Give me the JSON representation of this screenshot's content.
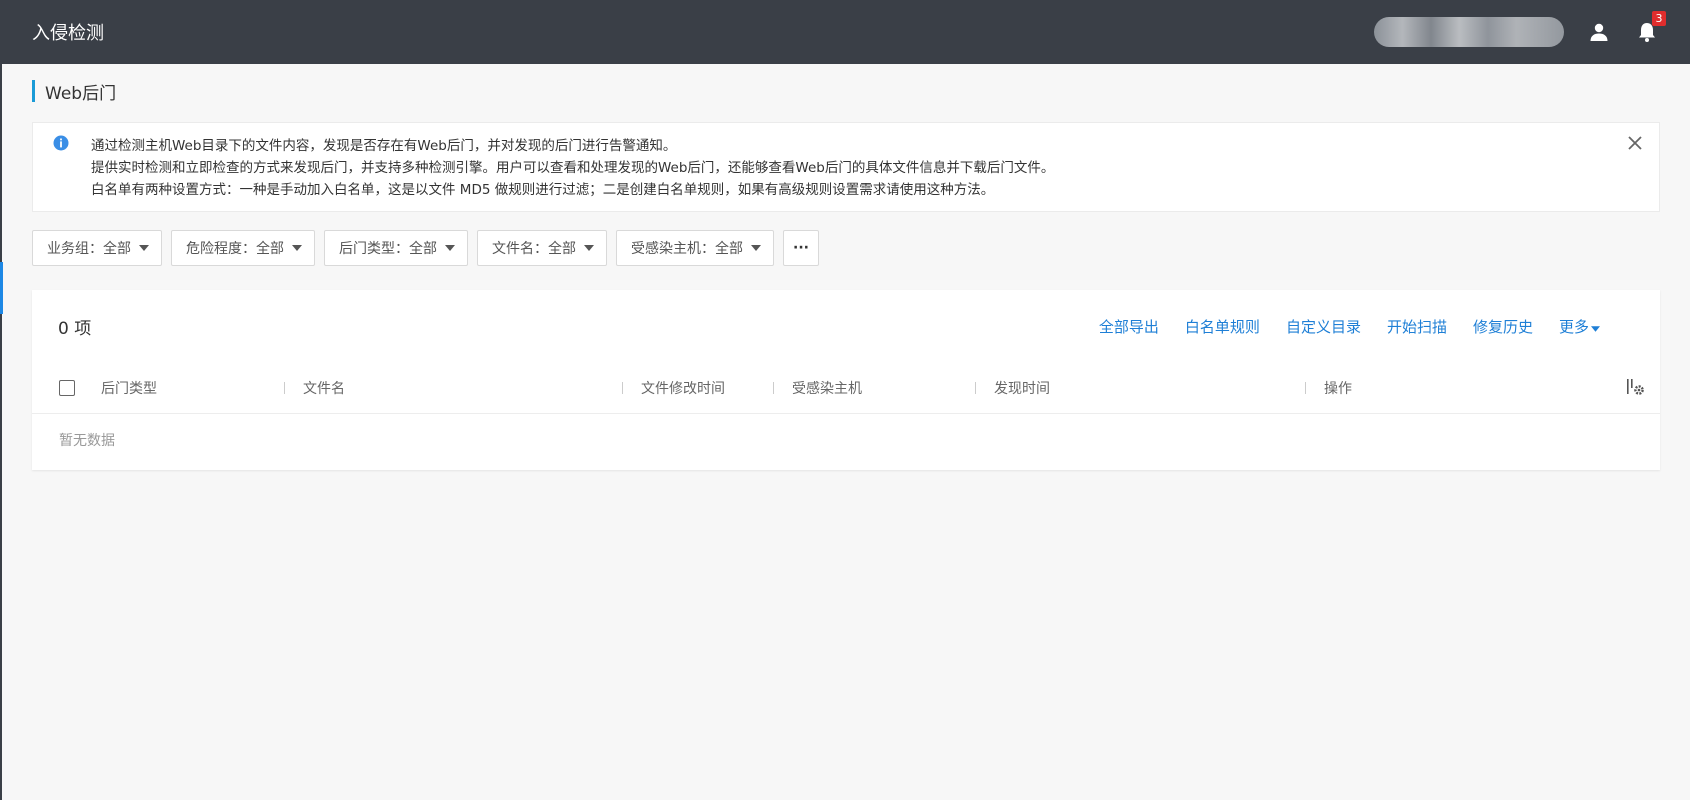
{
  "header": {
    "title": "入侵检测",
    "notification_count": "3"
  },
  "page": {
    "heading": "Web后门"
  },
  "info": {
    "lines": [
      "通过检测主机Web目录下的文件内容，发现是否存在有Web后门，并对发现的后门进行告警通知。",
      "提供实时检测和立即检查的方式来发现后门，并支持多种检测引擎。用户可以查看和处理发现的Web后门，还能够查看Web后门的具体文件信息并下载后门文件。",
      "白名单有两种设置方式：一种是手动加入白名单，这是以文件 MD5 做规则进行过滤；二是创建白名单规则，如果有高级规则设置需求请使用这种方法。"
    ]
  },
  "filters": [
    {
      "label": "业务组：全部"
    },
    {
      "label": "危险程度：全部"
    },
    {
      "label": "后门类型：全部"
    },
    {
      "label": "文件名：全部"
    },
    {
      "label": "受感染主机：全部"
    }
  ],
  "more_glyph": "···",
  "table": {
    "count_label": "0 项",
    "actions": [
      "全部导出",
      "白名单规则",
      "自定义目录",
      "开始扫描",
      "修复历史",
      "更多"
    ],
    "columns": [
      "后门类型",
      "文件名",
      "文件修改时间",
      "受感染主机",
      "发现时间",
      "操作"
    ],
    "empty_text": "暂无数据"
  },
  "colors": {
    "topbar": "#3a3f47",
    "accent": "#1e7fd6",
    "heading_bar": "#1a9bd7",
    "badge": "#e02d2d"
  }
}
